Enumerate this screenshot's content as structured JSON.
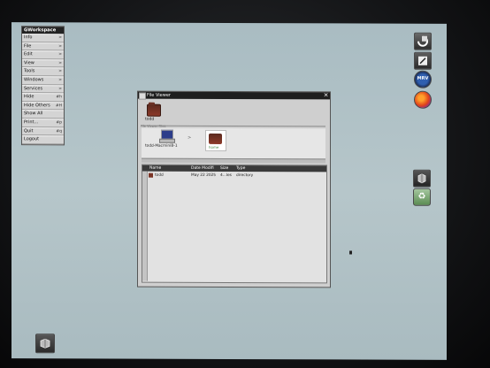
{
  "menu": {
    "title": "GWorkspace",
    "items": [
      {
        "label": "Info",
        "key": ">"
      },
      {
        "label": "File",
        "key": ">"
      },
      {
        "label": "Edit",
        "key": ">"
      },
      {
        "label": "View",
        "key": ">"
      },
      {
        "label": "Tools",
        "key": ">"
      },
      {
        "label": "Windows",
        "key": ">"
      },
      {
        "label": "Services",
        "key": ">"
      },
      {
        "label": "Hide",
        "key": "#h"
      },
      {
        "label": "Hide Others",
        "key": "#H"
      },
      {
        "label": "Show All",
        "key": ""
      },
      {
        "label": "Print...",
        "key": "#p"
      },
      {
        "label": "Quit",
        "key": "#q"
      },
      {
        "label": "Logout",
        "key": ""
      }
    ]
  },
  "dock": {
    "icons": [
      "gworkspace-icon",
      "terminal-icon",
      "mrv-icon",
      "firefox-icon",
      "viewer-icon",
      "recycler-icon"
    ],
    "mrv_label": "MRV"
  },
  "viewer": {
    "title": "File Viewer",
    "shelf": {
      "folder_label": "todd",
      "sub": "File Viewer Files"
    },
    "path": {
      "computer_label": "todd-MacminiB-1",
      "home_label": "home",
      "separator": ">"
    },
    "columns": [
      "Name",
      "Date Modifi",
      "Size",
      "Type"
    ],
    "rows": [
      {
        "name": "todd",
        "date": "May 22 2025",
        "size": "4...les",
        "type": "directory"
      }
    ]
  },
  "colors": {
    "desktop": "#b6c6ca",
    "titlebar": "#1e1e1e",
    "folder": "#7a3426"
  }
}
